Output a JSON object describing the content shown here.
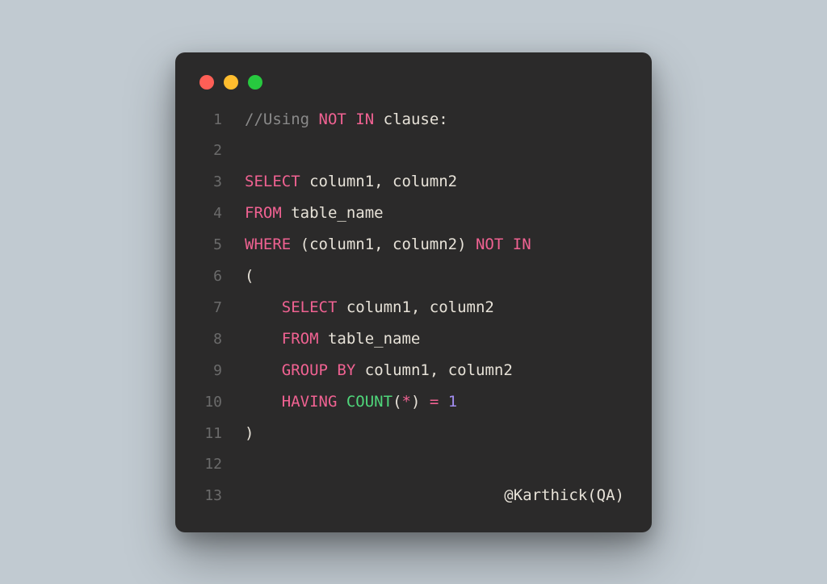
{
  "window": {
    "traffic_lights": [
      "red",
      "yellow",
      "green"
    ]
  },
  "code": {
    "line_count": 13,
    "lines": {
      "l1": {
        "t1": "//Using ",
        "t2": "NOT",
        "t3": " ",
        "t4": "IN",
        "t5": " clause:"
      },
      "l3": {
        "t1": "SELECT",
        "t2": " column1, column2"
      },
      "l4": {
        "t1": "FROM",
        "t2": " table_name"
      },
      "l5": {
        "t1": "WHERE",
        "t2": " (column1, column2) ",
        "t3": "NOT",
        "t4": " ",
        "t5": "IN"
      },
      "l6": {
        "t1": "("
      },
      "l7": {
        "indent": "    ",
        "t1": "SELECT",
        "t2": " column1, column2"
      },
      "l8": {
        "indent": "    ",
        "t1": "FROM",
        "t2": " table_name"
      },
      "l9": {
        "indent": "    ",
        "t1": "GROUP",
        "t2": " ",
        "t3": "BY",
        "t4": " column1, column2"
      },
      "l10": {
        "indent": "    ",
        "t1": "HAVING",
        "t2": " ",
        "t3": "COUNT",
        "t4": "(",
        "t5": "*",
        "t6": ") ",
        "t7": "=",
        "t8": " ",
        "t9": "1"
      },
      "l11": {
        "t1": ")"
      },
      "l13": {
        "t1": "@Karthick(QA)"
      }
    },
    "gutter": {
      "n1": "1",
      "n2": "2",
      "n3": "3",
      "n4": "4",
      "n5": "5",
      "n6": "6",
      "n7": "7",
      "n8": "8",
      "n9": "9",
      "n10": "10",
      "n11": "11",
      "n12": "12",
      "n13": "13"
    }
  },
  "colors": {
    "background": "#c1cad1",
    "editor_bg": "#2b2a2a",
    "pink": "#f06292",
    "green": "#4fd67a",
    "purple": "#a28df0",
    "text": "#e7e2d8",
    "gutter": "#6b6b6b"
  }
}
